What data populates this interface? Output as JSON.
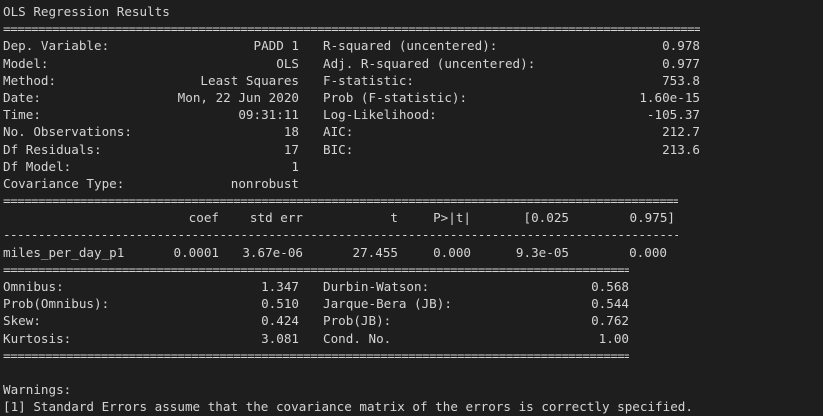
{
  "title": "OLS Regression Results",
  "rule_eq": "================================================================================================================================================",
  "rule_dash": "------------------------------------------------------------------------------------------------------------------------------------------------",
  "top": [
    {
      "l1": "Dep. Variable:",
      "v1": "PADD 1",
      "l2": "R-squared (uncentered):",
      "v2": "0.978"
    },
    {
      "l1": "Model:",
      "v1": "OLS",
      "l2": "Adj. R-squared (uncentered):",
      "v2": "0.977"
    },
    {
      "l1": "Method:",
      "v1": "Least Squares",
      "l2": "F-statistic:",
      "v2": "753.8"
    },
    {
      "l1": "Date:",
      "v1": "Mon, 22 Jun 2020",
      "l2": "Prob (F-statistic):",
      "v2": "1.60e-15"
    },
    {
      "l1": "Time:",
      "v1": "09:31:11",
      "l2": "Log-Likelihood:",
      "v2": "-105.37"
    },
    {
      "l1": "No. Observations:",
      "v1": "18",
      "l2": "AIC:",
      "v2": "212.7"
    },
    {
      "l1": "Df Residuals:",
      "v1": "17",
      "l2": "BIC:",
      "v2": "213.6"
    },
    {
      "l1": "Df Model:",
      "v1": "1",
      "l2": "",
      "v2": ""
    },
    {
      "l1": "Covariance Type:",
      "v1": "nonrobust",
      "l2": "",
      "v2": ""
    }
  ],
  "coef_header": [
    "coef",
    "std err",
    "t",
    "P>|t|",
    "[0.025",
    "0.975]"
  ],
  "coef_rows": [
    {
      "name": "miles_per_day_p1",
      "values": [
        "0.0001",
        "3.67e-06",
        "27.455",
        "0.000",
        "9.3e-05",
        "0.000"
      ]
    }
  ],
  "diag": [
    {
      "l1": "Omnibus:",
      "v1": "1.347",
      "l2": "Durbin-Watson:",
      "v2": "0.568"
    },
    {
      "l1": "Prob(Omnibus):",
      "v1": "0.510",
      "l2": "Jarque-Bera (JB):",
      "v2": "0.544"
    },
    {
      "l1": "Skew:",
      "v1": "0.424",
      "l2": "Prob(JB):",
      "v2": "0.762"
    },
    {
      "l1": "Kurtosis:",
      "v1": "3.081",
      "l2": "Cond. No.",
      "v2": "1.00"
    }
  ],
  "warnings_title": "Warnings:",
  "warnings": [
    "[1] Standard Errors assume that the covariance matrix of the errors is correctly specified."
  ]
}
